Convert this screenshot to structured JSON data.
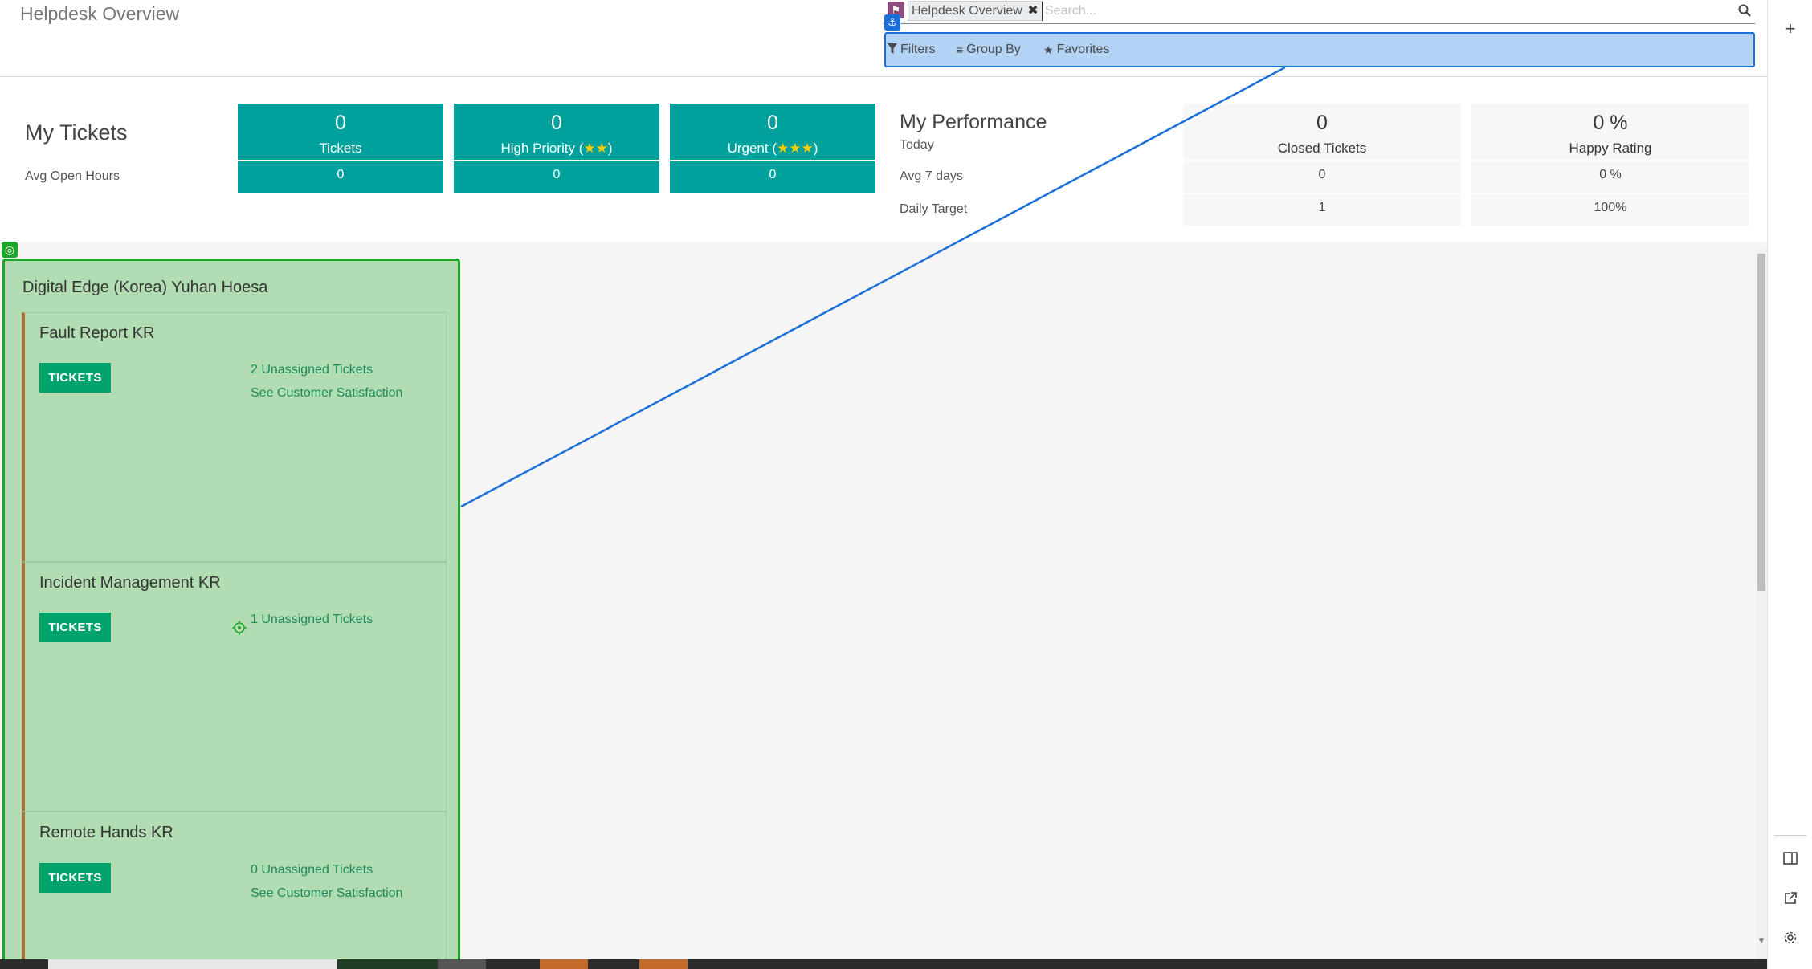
{
  "header": {
    "title": "Helpdesk Overview",
    "facet_label": "Helpdesk Overview",
    "facet_remove": "✖",
    "search_placeholder": "Search...",
    "filters_label": "Filters",
    "groupby_label": "Group By",
    "favorites_label": "Favorites"
  },
  "my_tickets": {
    "title": "My Tickets",
    "avg_label": "Avg Open Hours",
    "columns": [
      {
        "count": "0",
        "label": "Tickets",
        "avg": "0"
      },
      {
        "count": "0",
        "label_prefix": "High Priority (",
        "stars": "★★",
        "label_suffix": ")",
        "avg": "0"
      },
      {
        "count": "0",
        "label_prefix": "Urgent (",
        "stars": "★★★",
        "label_suffix": ")",
        "avg": "0"
      }
    ]
  },
  "my_performance": {
    "title": "My Performance",
    "today_label": "Today",
    "avg7_label": "Avg 7 days",
    "target_label": "Daily Target",
    "columns": [
      {
        "today": "0",
        "label": "Closed Tickets",
        "avg7": "0",
        "target": "1"
      },
      {
        "today": "0 %",
        "label": "Happy Rating",
        "avg7": "0 %",
        "target": "100%"
      }
    ]
  },
  "kanban": {
    "company": "Digital Edge (Korea) Yuhan Hoesa",
    "teams": [
      {
        "name": "Fault Report KR",
        "button": "TICKETS",
        "links": [
          "2 Unassigned Tickets",
          "See Customer Satisfaction"
        ]
      },
      {
        "name": "Incident Management KR",
        "button": "TICKETS",
        "links": [
          "1 Unassigned Tickets"
        ]
      },
      {
        "name": "Remote Hands KR",
        "button": "TICKETS",
        "links": [
          "0 Unassigned Tickets",
          "See Customer Satisfaction"
        ]
      }
    ]
  },
  "colors": {
    "teal": "#00a09d",
    "selection_blue": "#1a6fd8",
    "group_green": "#1ea52a",
    "button_green": "#00a36c"
  },
  "icons": [
    "filter-icon",
    "group-by-icon",
    "star-icon",
    "search-icon",
    "anchor-icon",
    "plus-icon",
    "panel-icon",
    "external-link-icon",
    "gear-icon",
    "target-icon"
  ]
}
